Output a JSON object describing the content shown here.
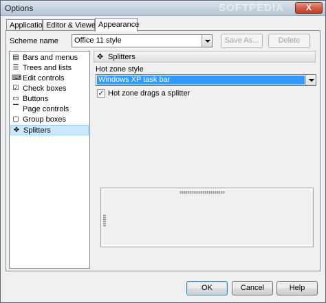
{
  "window": {
    "title": "Options",
    "close_label": "X",
    "watermark": "SOFTPEDIA"
  },
  "tabs": [
    {
      "label": "Application"
    },
    {
      "label": "Editor & Viewers"
    },
    {
      "label": "Appearance"
    }
  ],
  "scheme": {
    "label": "Scheme name",
    "value": "Office 11 style",
    "save_as_label": "Save As...",
    "delete_label": "Delete"
  },
  "sidebar": {
    "items": [
      {
        "label": "Bars and menus",
        "icon": "bars-menu-icon"
      },
      {
        "label": "Trees and lists",
        "icon": "tree-list-icon"
      },
      {
        "label": "Edit controls",
        "icon": "edit-control-icon"
      },
      {
        "label": "Check boxes",
        "icon": "checkbox-icon"
      },
      {
        "label": "Buttons",
        "icon": "button-icon"
      },
      {
        "label": "Page controls",
        "icon": "page-control-icon"
      },
      {
        "label": "Group boxes",
        "icon": "group-box-icon"
      },
      {
        "label": "Splitters",
        "icon": "splitter-icon",
        "selected": true
      }
    ]
  },
  "content": {
    "header_label": "Splitters",
    "hot_zone_label": "Hot zone style",
    "hot_zone_value": "Windows XP task bar",
    "drag_checkbox_label": "Hot zone drags a splitter",
    "drag_checked": true
  },
  "footer": {
    "ok_label": "OK",
    "cancel_label": "Cancel",
    "help_label": "Help"
  }
}
